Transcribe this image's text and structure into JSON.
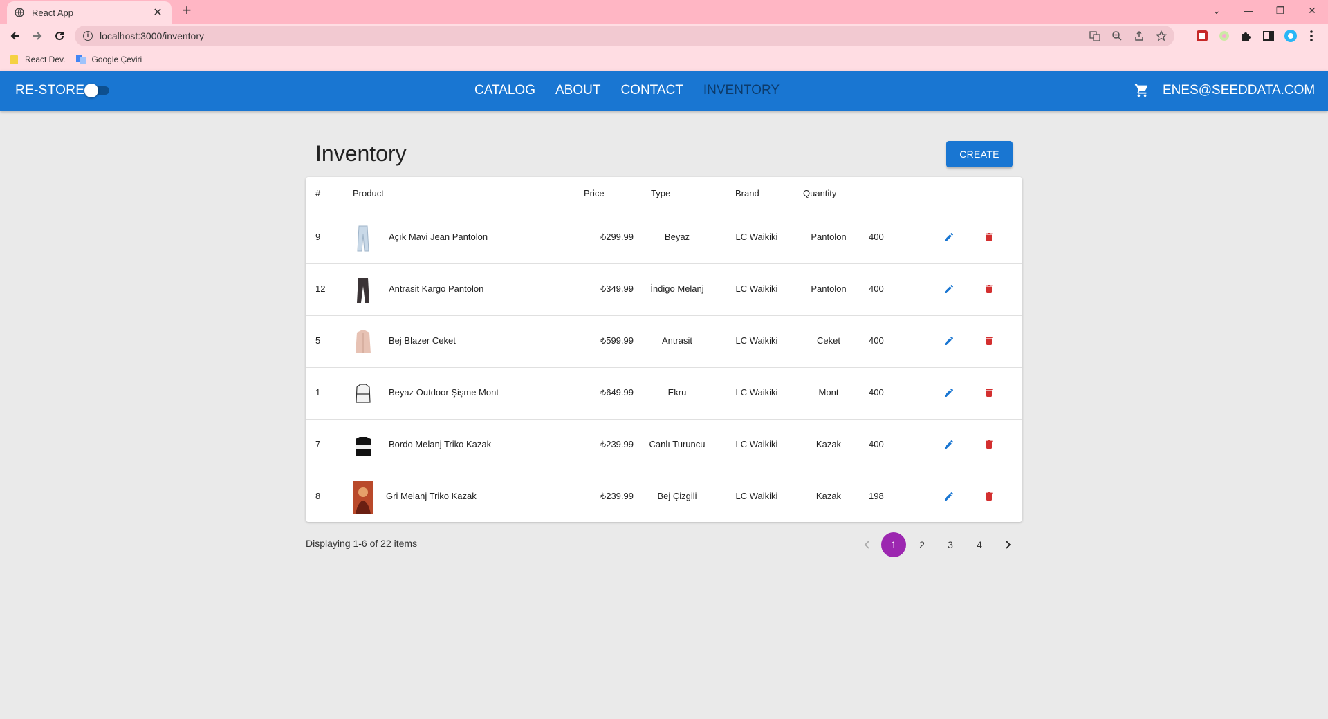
{
  "browser": {
    "tab_title": "React App",
    "url": "localhost:3000/inventory",
    "bookmarks": [
      "React Dev.",
      "Google Çeviri"
    ]
  },
  "appbar": {
    "brand": "RE-STORE",
    "nav": [
      "CATALOG",
      "ABOUT",
      "CONTACT",
      "INVENTORY"
    ],
    "active_nav": "INVENTORY",
    "user": "ENES@SEEDDATA.COM",
    "color": "#1976d2"
  },
  "page": {
    "title": "Inventory",
    "create_label": "CREATE"
  },
  "table": {
    "headers": [
      "#",
      "Product",
      "Price",
      "Type",
      "Brand",
      "Quantity"
    ],
    "rows": [
      {
        "id": "9",
        "name": "Açık Mavi Jean Pantolon",
        "price": "₺299.99",
        "type": "Beyaz",
        "brand": "LC Waikiki",
        "category": "Pantolon",
        "quantity": "400",
        "thumb": "light-jeans"
      },
      {
        "id": "12",
        "name": "Antrasit Kargo Pantolon",
        "price": "₺349.99",
        "type": "İndigo Melanj",
        "brand": "LC Waikiki",
        "category": "Pantolon",
        "quantity": "400",
        "thumb": "dark-pants"
      },
      {
        "id": "5",
        "name": "Bej Blazer Ceket",
        "price": "₺599.99",
        "type": "Antrasit",
        "brand": "LC Waikiki",
        "category": "Ceket",
        "quantity": "400",
        "thumb": "beige-blazer"
      },
      {
        "id": "1",
        "name": "Beyaz Outdoor Şişme Mont",
        "price": "₺649.99",
        "type": "Ekru",
        "brand": "LC Waikiki",
        "category": "Mont",
        "quantity": "400",
        "thumb": "white-coat"
      },
      {
        "id": "7",
        "name": "Bordo Melanj Triko Kazak",
        "price": "₺239.99",
        "type": "Canlı Turuncu",
        "brand": "LC Waikiki",
        "category": "Kazak",
        "quantity": "400",
        "thumb": "black-sweater"
      },
      {
        "id": "8",
        "name": "Gri Melanj Triko Kazak",
        "price": "₺239.99",
        "type": "Bej Çizgili",
        "brand": "LC Waikiki",
        "category": "Kazak",
        "quantity": "198",
        "thumb": "photo"
      }
    ]
  },
  "footer": {
    "display_text": "Displaying 1-6 of 22 items",
    "pages": [
      "1",
      "2",
      "3",
      "4"
    ],
    "current_page": "1",
    "page_color": "#9c27b0"
  },
  "icons": {
    "edit": "pencil-icon",
    "delete": "trash-icon",
    "edit_color": "#1976d2",
    "delete_color": "#d32f2f"
  }
}
